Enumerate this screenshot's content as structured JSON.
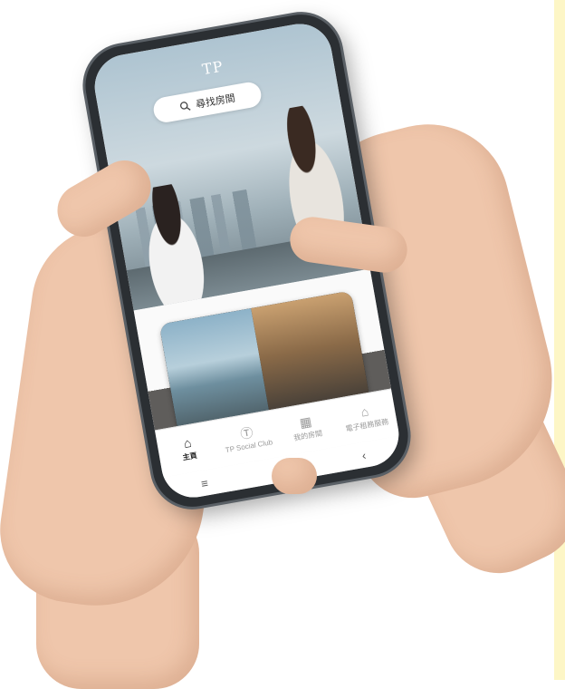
{
  "app": {
    "logo": "TP",
    "search": {
      "placeholder": "尋找房間"
    }
  },
  "tabbar": {
    "items": [
      {
        "label": "主頁",
        "icon": "home-icon",
        "active": true
      },
      {
        "label": "TP Social Club",
        "icon": "tp-logo-icon",
        "active": false
      },
      {
        "label": "我的房間",
        "icon": "room-icon",
        "active": false
      },
      {
        "label": "電子租務服務",
        "icon": "house-icon",
        "active": false
      }
    ]
  },
  "system_nav": {
    "menu_icon": "≡",
    "home_icon": "▢",
    "back_icon": "‹"
  },
  "colors": {
    "accent_strip": "#fdf6c6",
    "tab_active": "#222222",
    "tab_inactive": "#9a9a9a"
  }
}
